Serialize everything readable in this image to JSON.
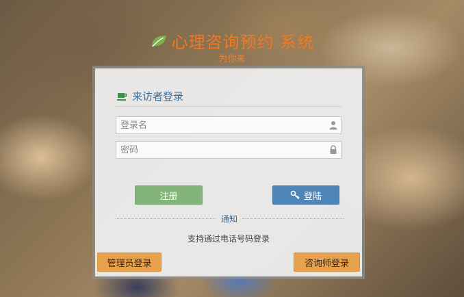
{
  "header": {
    "title": "心理咨询预约 系统",
    "subtitle": "为你来"
  },
  "login": {
    "title": "来访者登录",
    "username_placeholder": "登录名",
    "password_placeholder": "密码",
    "register_label": "注册",
    "login_label": "登陆"
  },
  "notice": {
    "label": "通知",
    "text": "支持通过电话号码登录"
  },
  "footer": {
    "admin_label": "管理员登录",
    "counselor_label": "咨询师登录"
  },
  "colors": {
    "brand": "#f07a24",
    "primary": "#4f86b8",
    "success": "#83b57a",
    "warning": "#e8a24e"
  },
  "icons": [
    "leaf-icon",
    "coffee-cup-icon",
    "user-icon",
    "lock-icon",
    "key-icon"
  ]
}
